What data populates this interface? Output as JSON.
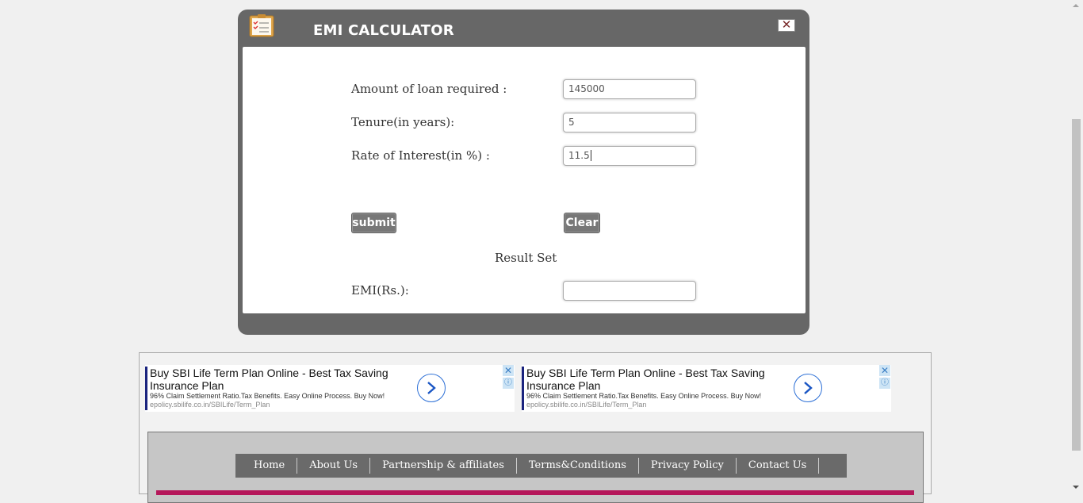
{
  "modal": {
    "title": "EMI CALCULATOR",
    "close_label": "✕",
    "icon": "clipboard-checklist-icon"
  },
  "form": {
    "loan_label": "Amount of loan required :",
    "loan_value": "145000",
    "tenure_label": "Tenure(in years):",
    "tenure_value": "5",
    "rate_label": "Rate of Interest(in %) :",
    "rate_value": "11.5",
    "submit_label": "submit",
    "clear_label": "Clear"
  },
  "result": {
    "heading": "Result Set",
    "emi_label": "EMI(Rs.):",
    "emi_value": ""
  },
  "ads": [
    {
      "title": "Buy SBI Life Term Plan Online - Best Tax Saving Insurance Plan",
      "description": "96% Claim Settlement Ratio.Tax Benefits. Easy Online Process. Buy Now!",
      "url": "epolicy.sbilife.co.in/SBILife/Term_Plan"
    },
    {
      "title": "Buy SBI Life Term Plan Online - Best Tax Saving Insurance Plan",
      "description": "96% Claim Settlement Ratio.Tax Benefits. Easy Online Process. Buy Now!",
      "url": "epolicy.sbilife.co.in/SBILife/Term_Plan"
    }
  ],
  "footer_nav": {
    "items": [
      "Home",
      "About Us",
      "Partnership & affiliates",
      "Terms&Conditions",
      "Privacy Policy",
      "Contact Us"
    ]
  },
  "colors": {
    "modal_bg": "#676767",
    "footer_strip": "#b5175a",
    "nav_bg": "#6a6a6a"
  }
}
